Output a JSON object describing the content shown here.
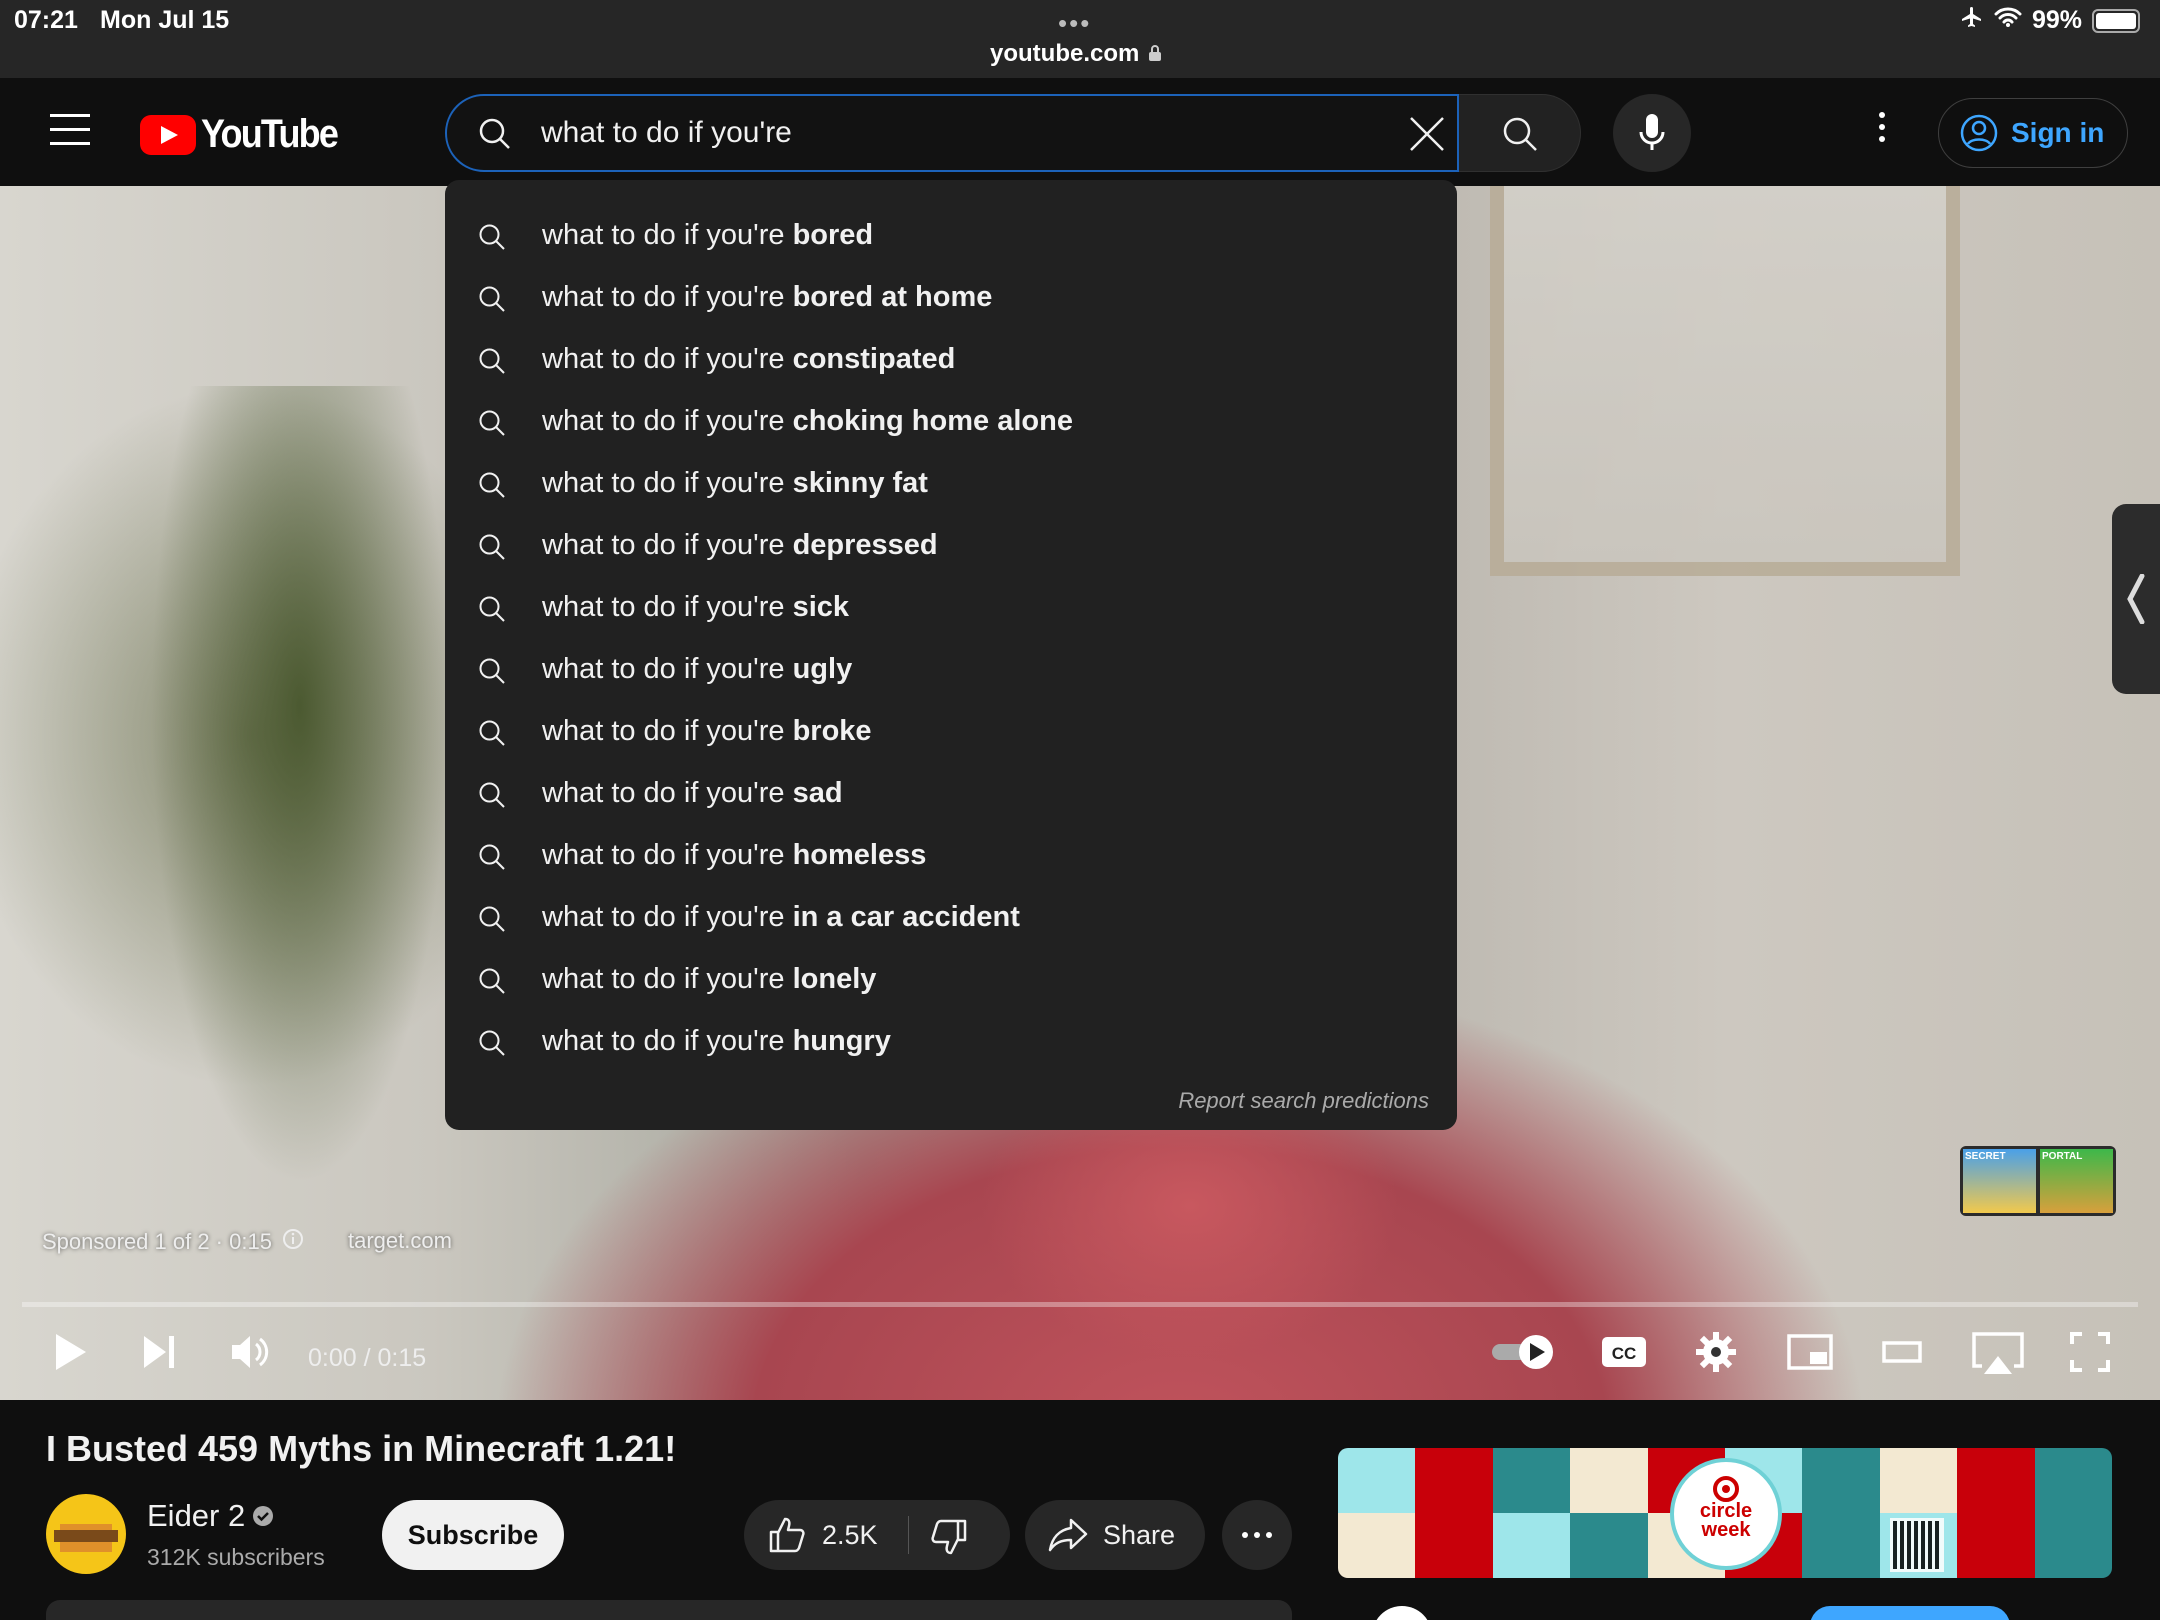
{
  "status_bar": {
    "time": "07:21",
    "date": "Mon Jul 15",
    "url": "youtube.com",
    "battery": "99%"
  },
  "header": {
    "logo_text": "YouTube",
    "search_value": "what to do if you're",
    "sign_in_label": "Sign in"
  },
  "suggestions": {
    "prefix": "what to do if you're",
    "items": [
      "bored",
      "bored at home",
      "constipated",
      "choking home alone",
      "skinny fat",
      "depressed",
      "sick",
      "ugly",
      "broke",
      "sad",
      "homeless",
      "in a car accident",
      "lonely",
      "hungry"
    ],
    "report_label": "Report search predictions"
  },
  "player": {
    "sponsored_label": "Sponsored 1 of 2 · 0:15",
    "advertiser": "target.com",
    "time_display": "0:00 / 0:15",
    "progress_fraction": 0,
    "thumb_labels": [
      "SECRET",
      "PORTAL"
    ]
  },
  "video": {
    "title": "I Busted 459 Myths in Minecraft 1.21!",
    "channel_name": "Eider 2",
    "subscribers": "312K subscribers",
    "subscribe_label": "Subscribe",
    "like_count": "2.5K",
    "share_label": "Share"
  },
  "ad": {
    "line1": "circle",
    "line2": "week",
    "colors": [
      "#9ee6ea",
      "#c8000a",
      "#2b8a8c",
      "#f3e9d2",
      "#c8000a",
      "#9ee6ea",
      "#2b8a8c",
      "#f3e9d2",
      "#c8000a",
      "#2b8a8c"
    ]
  }
}
